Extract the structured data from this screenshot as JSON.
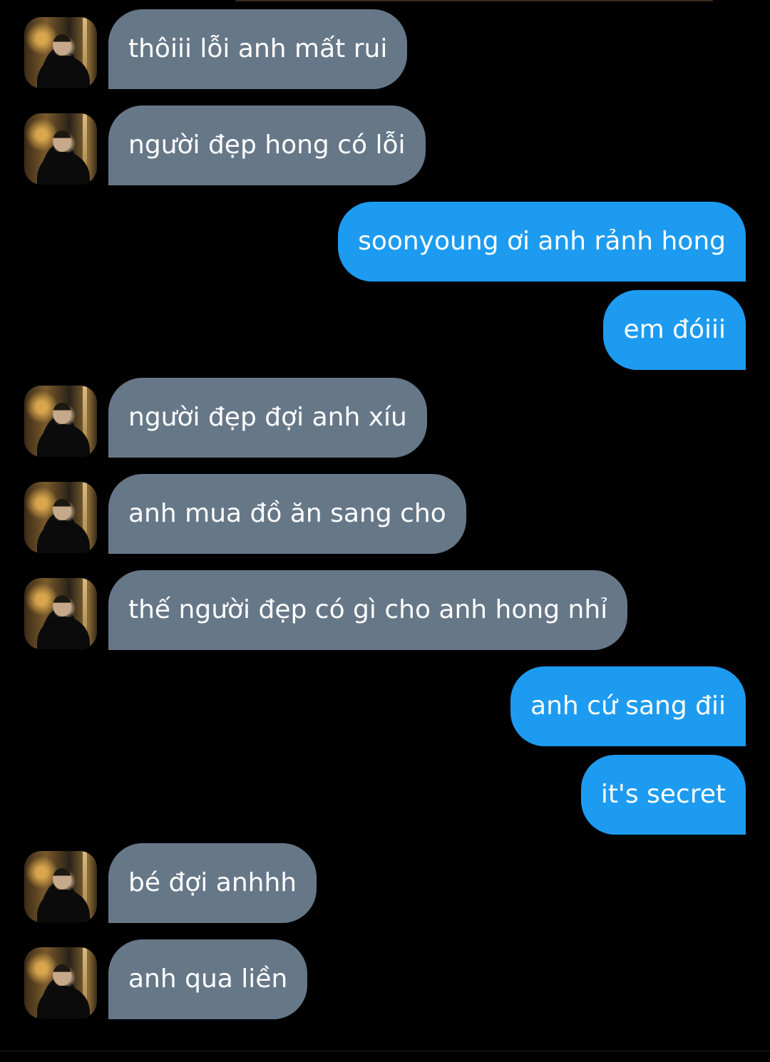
{
  "theme": {
    "background": "#000000",
    "incoming_bubble": "#667788",
    "outgoing_bubble": "#1d9bf0",
    "text": "#ffffff"
  },
  "avatar_icon": "profile-photo-icon",
  "messages": [
    {
      "direction": "in",
      "text": "thôiii lỗi anh mất rui"
    },
    {
      "direction": "in",
      "text": "người đẹp hong có lỗi"
    },
    {
      "direction": "out",
      "text": "soonyoung ơi anh rảnh hong"
    },
    {
      "direction": "out",
      "text": "em đóiii"
    },
    {
      "direction": "in",
      "text": "người đẹp đợi anh xíu"
    },
    {
      "direction": "in",
      "text": "anh mua đồ ăn sang cho"
    },
    {
      "direction": "in",
      "text": "thế người đẹp có gì cho anh hong nhỉ"
    },
    {
      "direction": "out",
      "text": "anh cứ sang đii"
    },
    {
      "direction": "out",
      "text": "it's secret"
    },
    {
      "direction": "in",
      "text": "bé đợi anhhh"
    },
    {
      "direction": "in",
      "text": "anh qua liền"
    }
  ]
}
